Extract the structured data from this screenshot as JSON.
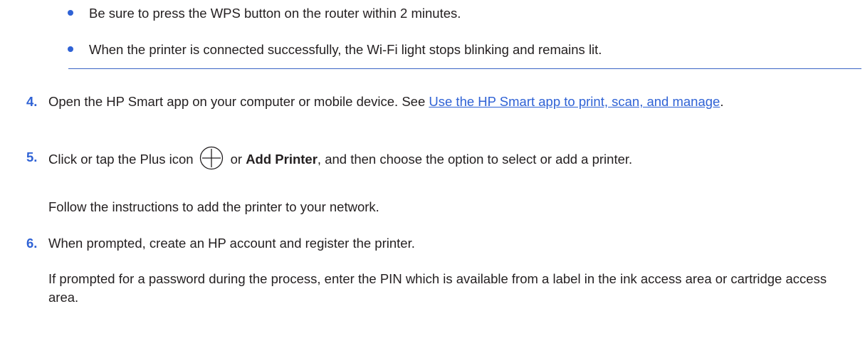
{
  "bullets": [
    "Be sure to press the WPS button on the router within 2 minutes.",
    "When the printer is connected successfully, the Wi-Fi light stops blinking and remains lit."
  ],
  "steps": {
    "s4": {
      "number": "4.",
      "text_before": "Open the HP Smart app on your computer or mobile device. See ",
      "link": "Use the HP Smart app to print, scan, and manage",
      "text_after": "."
    },
    "s5": {
      "number": "5.",
      "text_before": "Click or tap the Plus icon",
      "bold": "Add Printer",
      "text_mid": "or",
      "text_after": ", and then choose the option to select or add a printer.",
      "follow_up": "Follow the instructions to add the printer to your network."
    },
    "s6": {
      "number": "6.",
      "text": "When prompted, create an HP account and register the printer.",
      "follow_up": "If prompted for a password during the process, enter the PIN which is available from a label in the ink access area or cartridge access area."
    }
  },
  "icons": {
    "plus": "plus-circle-icon"
  },
  "colors": {
    "accent": "#2f62d5",
    "text": "#231f20",
    "rule": "#3b64c4"
  }
}
